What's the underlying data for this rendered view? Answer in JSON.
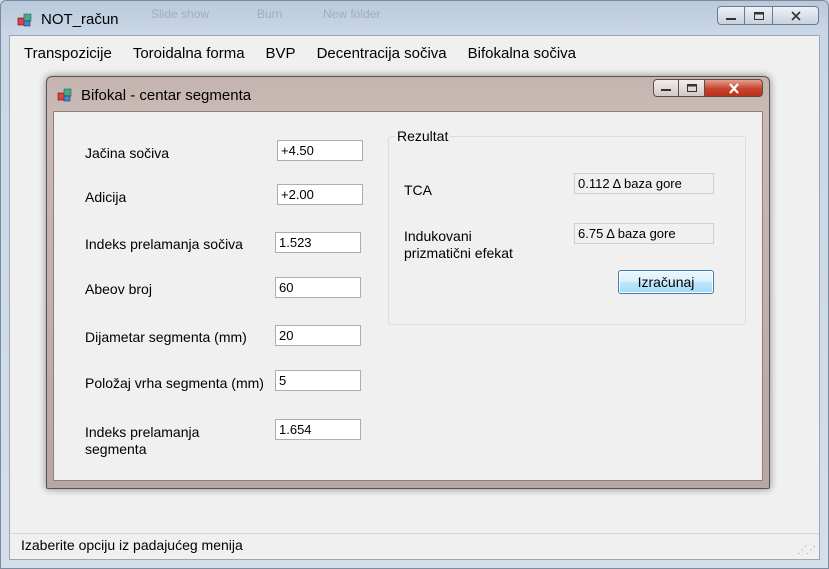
{
  "main_window": {
    "title": "NOT_račun",
    "ghost_toolbar": [
      "Slide show",
      "Burn",
      "New folder"
    ],
    "menu": [
      "Transpozicije",
      "Toroidalna forma",
      "BVP",
      "Decentracija sočiva",
      "Bifokalna sočiva"
    ],
    "status": "Izaberite opciju iz padajućeg menija"
  },
  "dialog": {
    "title": "Bifokal - centar segmenta",
    "fields": [
      {
        "label": "Jačina sočiva",
        "value": "+4.50"
      },
      {
        "label": "Adicija",
        "value": "+2.00"
      },
      {
        "label": "Indeks prelamanja sočiva",
        "value": "1.523"
      },
      {
        "label": "Abeov broj",
        "value": "60"
      },
      {
        "label": "Dijametar segmenta (mm)",
        "value": "20"
      },
      {
        "label": "Položaj vrha segmenta (mm)",
        "value": "5"
      },
      {
        "label": "Indeks prelamanja segmenta",
        "value": "1.654"
      }
    ],
    "result": {
      "group_title": "Rezultat",
      "tca_label": "TCA",
      "tca_value": "0.112 Δ baza gore",
      "prism_label": "Indukovani prizmatični efekat",
      "prism_value": "6.75 Δ baza gore",
      "button": "Izračunaj"
    }
  },
  "icons": {
    "app": "app-window-icon",
    "dialog": "app-window-icon",
    "minimize": "minimize-icon",
    "maximize": "maximize-icon",
    "close": "close-icon",
    "grip": "resize-grip-icon"
  }
}
